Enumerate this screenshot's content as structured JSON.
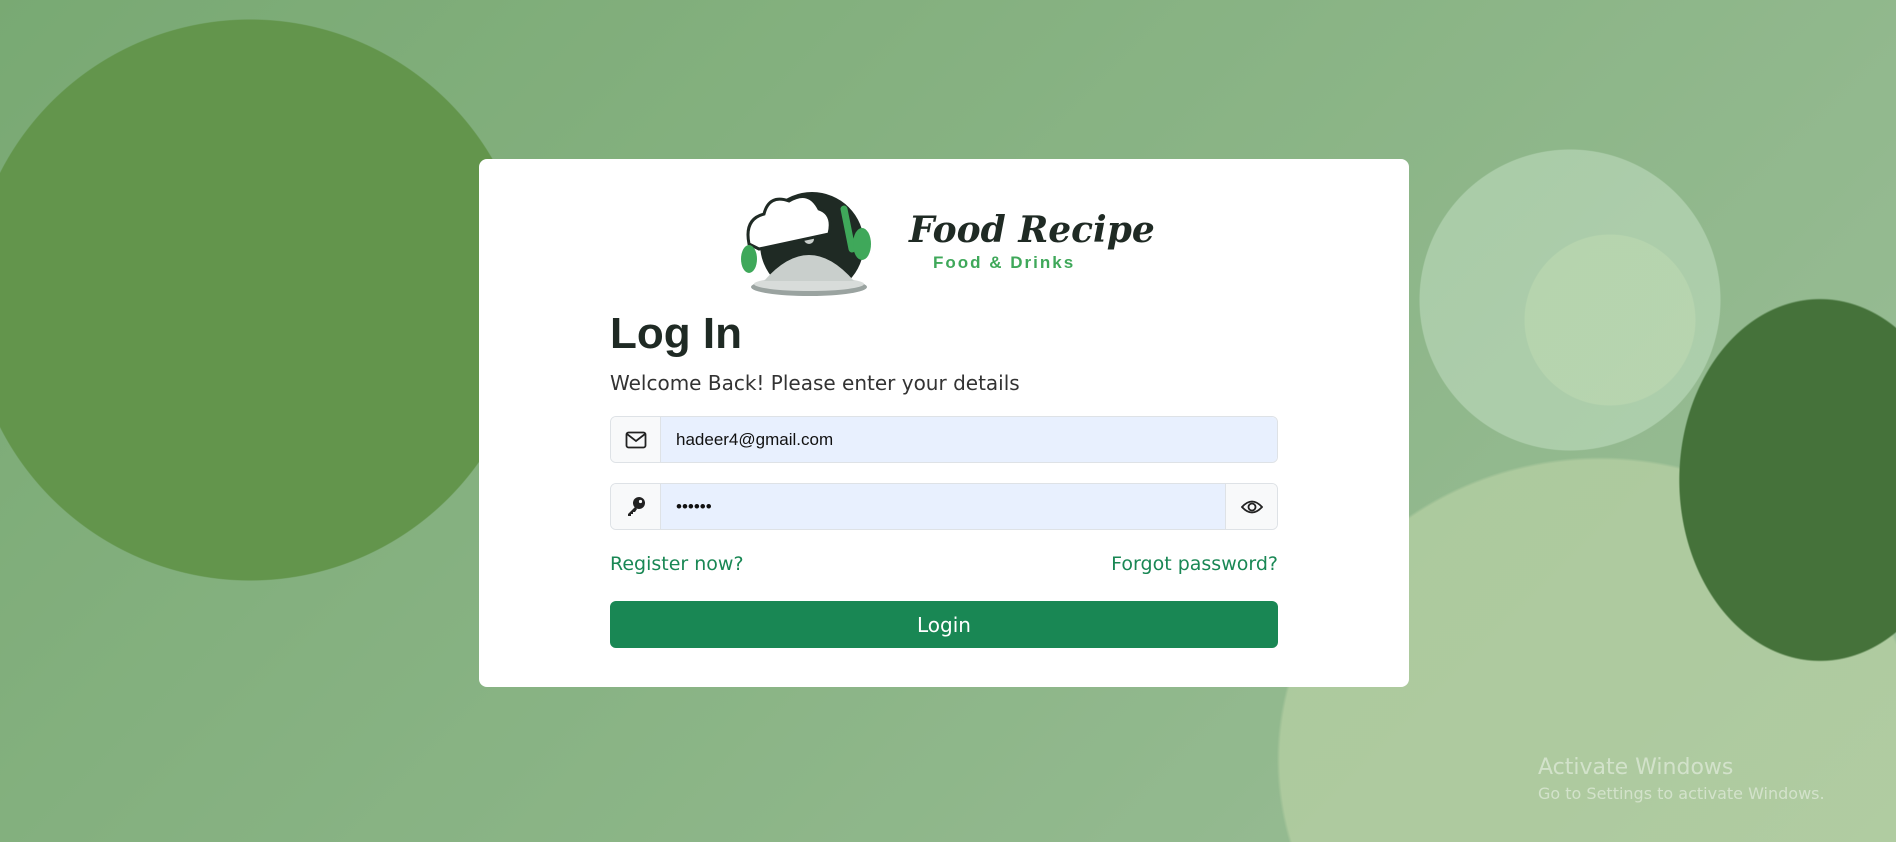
{
  "brand": {
    "title": "Food Recipe",
    "subtitle": "Food & Drinks"
  },
  "login": {
    "title": "Log In",
    "subtitle": "Welcome Back! Please enter your details",
    "email_value": "hadeer4@gmail.com",
    "email_icon": "envelope-icon",
    "password_value": "••••••",
    "password_icon": "key-icon",
    "toggle_icon": "eye-icon",
    "register_link": "Register now?",
    "forgot_link": "Forgot password?",
    "login_button": "Login"
  },
  "colors": {
    "accent": "#198754",
    "overlay": "#50a050",
    "card": "#ffffff",
    "input_bg": "#e8f0fe"
  },
  "watermark": {
    "title": "Activate Windows",
    "subtitle": "Go to Settings to activate Windows."
  }
}
